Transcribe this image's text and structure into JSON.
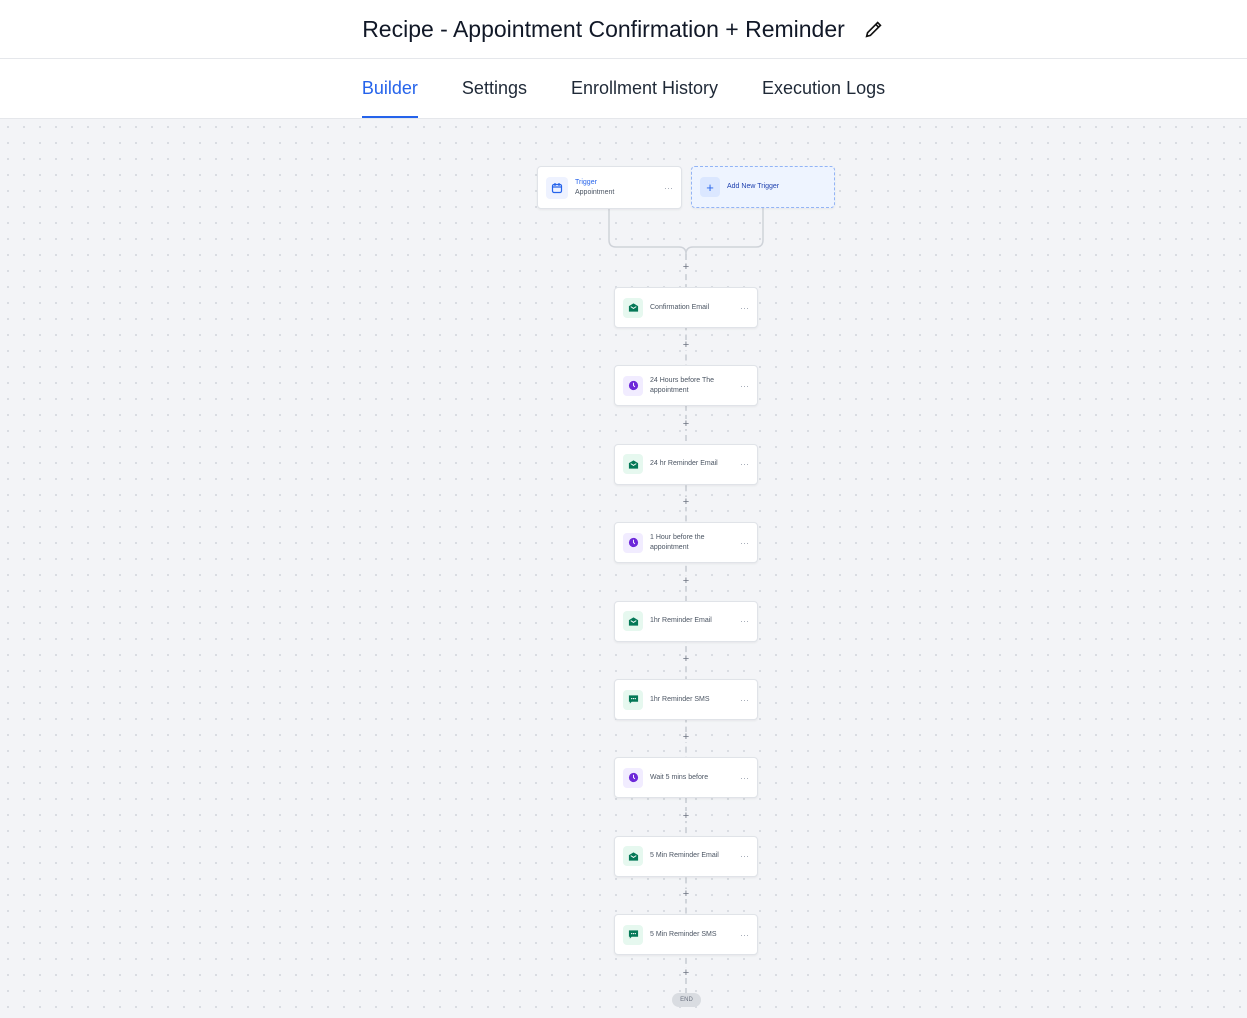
{
  "header": {
    "title": "Recipe - Appointment Confirmation + Reminder"
  },
  "tabs": [
    {
      "label": "Builder",
      "active": true
    },
    {
      "label": "Settings"
    },
    {
      "label": "Enrollment History"
    },
    {
      "label": "Execution Logs"
    }
  ],
  "trigger": {
    "title": "Trigger",
    "subtitle": "Appointment"
  },
  "add_trigger": {
    "label": "Add New Trigger"
  },
  "steps": [
    {
      "label": "Confirmation Email",
      "type": "email"
    },
    {
      "label": "24 Hours before The appointment",
      "type": "wait"
    },
    {
      "label": "24 hr Reminder Email",
      "type": "email"
    },
    {
      "label": "1 Hour before the appointment",
      "type": "wait"
    },
    {
      "label": "1hr Reminder Email",
      "type": "email"
    },
    {
      "label": "1hr Reminder SMS",
      "type": "sms"
    },
    {
      "label": "Wait 5 mins before",
      "type": "wait"
    },
    {
      "label": "5 Min Reminder Email",
      "type": "email"
    },
    {
      "label": "5 Min Reminder SMS",
      "type": "sms"
    }
  ],
  "end_label": "END",
  "more_glyph": "···",
  "plus_glyph": "+",
  "colors": {
    "accent": "#2563eb",
    "email": "#047857",
    "wait": "#6d28d9",
    "sms": "#047857"
  }
}
